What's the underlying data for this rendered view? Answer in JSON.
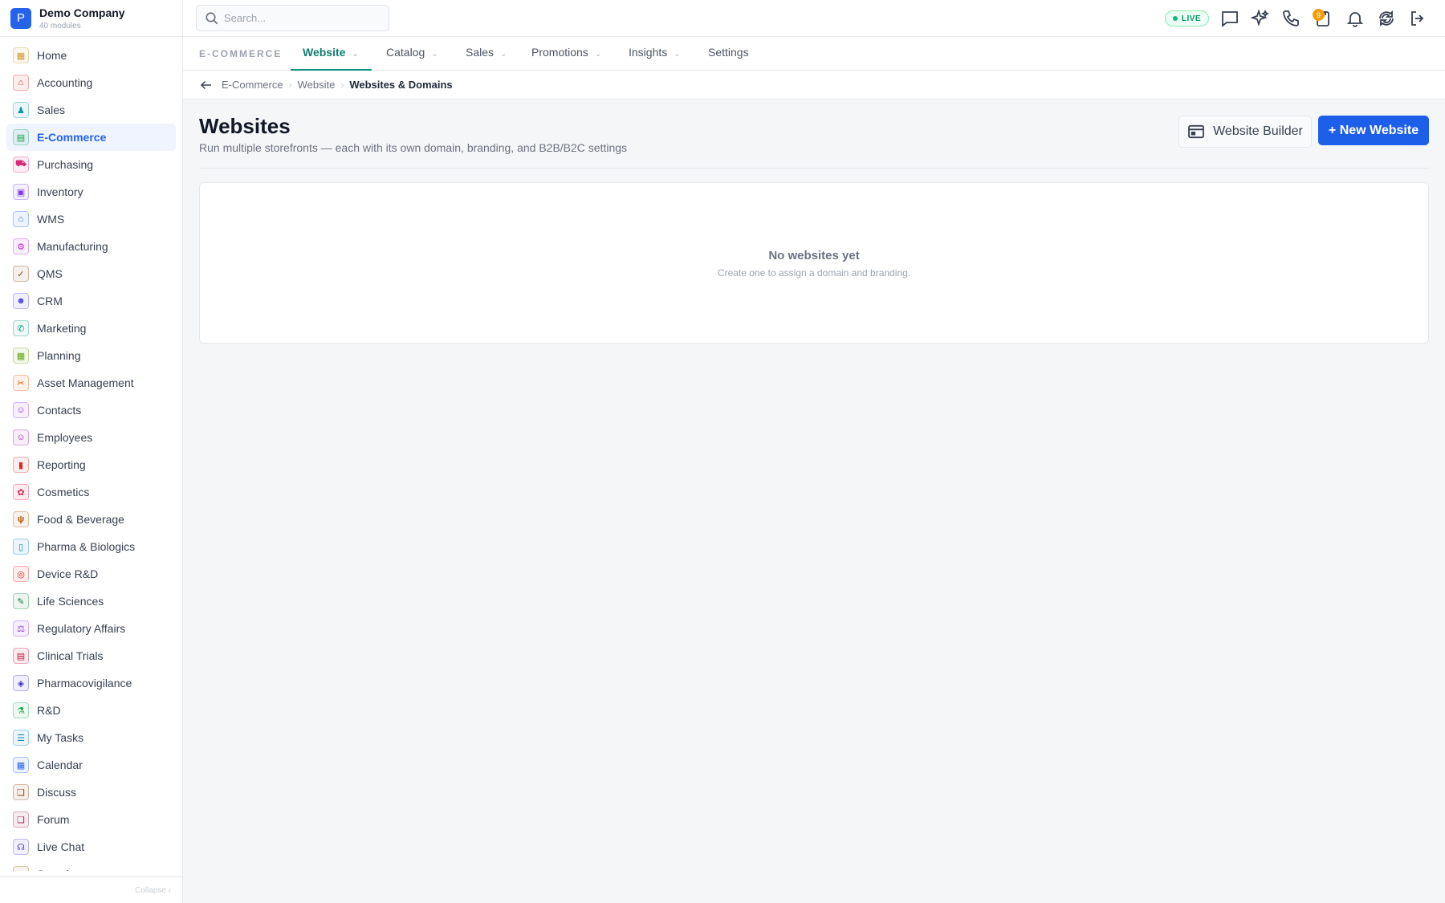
{
  "company": {
    "initial": "P",
    "name": "Demo Company",
    "modules_count": "40 modules"
  },
  "sidebar": {
    "items": [
      {
        "label": "Home",
        "icon": "grid-icon",
        "color": "#c99a2e",
        "glyph": "▦"
      },
      {
        "label": "Accounting",
        "icon": "bank-icon",
        "color": "#dc2626",
        "glyph": "⌂"
      },
      {
        "label": "Sales",
        "icon": "user-tie-icon",
        "color": "#0891b2",
        "glyph": "♟"
      },
      {
        "label": "E-Commerce",
        "icon": "storefront-icon",
        "color": "#16a34a",
        "glyph": "▤",
        "active": true
      },
      {
        "label": "Purchasing",
        "icon": "cart-icon",
        "color": "#db2777",
        "glyph": "⛟"
      },
      {
        "label": "Inventory",
        "icon": "box-icon",
        "color": "#7c3aed",
        "glyph": "▣"
      },
      {
        "label": "WMS",
        "icon": "warehouse-icon",
        "color": "#2563eb",
        "glyph": "⌂"
      },
      {
        "label": "Manufacturing",
        "icon": "factory-icon",
        "color": "#c026d3",
        "glyph": "⚙"
      },
      {
        "label": "QMS",
        "icon": "check-badge-icon",
        "color": "#92400e",
        "glyph": "✓"
      },
      {
        "label": "CRM",
        "icon": "users-icon",
        "color": "#4f46e5",
        "glyph": "☻"
      },
      {
        "label": "Marketing",
        "icon": "megaphone-icon",
        "color": "#0d9488",
        "glyph": "✆"
      },
      {
        "label": "Planning",
        "icon": "calendar-grid-icon",
        "color": "#65a30d",
        "glyph": "▦"
      },
      {
        "label": "Asset Management",
        "icon": "tools-icon",
        "color": "#ea580c",
        "glyph": "✂"
      },
      {
        "label": "Contacts",
        "icon": "contact-card-icon",
        "color": "#9333ea",
        "glyph": "☺"
      },
      {
        "label": "Employees",
        "icon": "badge-icon",
        "color": "#a21caf",
        "glyph": "☺"
      },
      {
        "label": "Reporting",
        "icon": "bar-chart-icon",
        "color": "#dc2626",
        "glyph": "▮"
      },
      {
        "label": "Cosmetics",
        "icon": "lotus-icon",
        "color": "#e11d48",
        "glyph": "✿"
      },
      {
        "label": "Food & Beverage",
        "icon": "fork-knife-icon",
        "color": "#b45309",
        "glyph": "ψ"
      },
      {
        "label": "Pharma & Biologics",
        "icon": "pill-bottle-icon",
        "color": "#0284c7",
        "glyph": "▯"
      },
      {
        "label": "Device R&D",
        "icon": "device-icon",
        "color": "#dc2626",
        "glyph": "◎"
      },
      {
        "label": "Life Sciences",
        "icon": "microscope-icon",
        "color": "#15803d",
        "glyph": "✎"
      },
      {
        "label": "Regulatory Affairs",
        "icon": "gavel-icon",
        "color": "#9333ea",
        "glyph": "⚖"
      },
      {
        "label": "Clinical Trials",
        "icon": "clipboard-icon",
        "color": "#be123c",
        "glyph": "▤"
      },
      {
        "label": "Pharmacovigilance",
        "icon": "shield-icon",
        "color": "#4338ca",
        "glyph": "◈"
      },
      {
        "label": "R&D",
        "icon": "flask-icon",
        "color": "#16a34a",
        "glyph": "⚗"
      },
      {
        "label": "My Tasks",
        "icon": "checklist-icon",
        "color": "#0284c7",
        "glyph": "☰"
      },
      {
        "label": "Calendar",
        "icon": "calendar-icon",
        "color": "#2563eb",
        "glyph": "▦"
      },
      {
        "label": "Discuss",
        "icon": "chat-bubbles-icon",
        "color": "#92400e",
        "glyph": "❏"
      },
      {
        "label": "Forum",
        "icon": "forum-icon",
        "color": "#9d174d",
        "glyph": "❏"
      },
      {
        "label": "Live Chat",
        "icon": "headset-icon",
        "color": "#4f46e5",
        "glyph": "☊"
      },
      {
        "label": "Sourcing",
        "icon": "globe-icon",
        "color": "#a16207",
        "glyph": "◉"
      }
    ],
    "collapse_label": "Collapse ‹"
  },
  "topbar": {
    "search_placeholder": "Search...",
    "live_label": "LIVE",
    "notifications_count": "9"
  },
  "tabs": {
    "module_label": "E-COMMERCE",
    "items": [
      {
        "label": "Website",
        "dropdown": true,
        "active": true
      },
      {
        "label": "Catalog",
        "dropdown": true
      },
      {
        "label": "Sales",
        "dropdown": true
      },
      {
        "label": "Promotions",
        "dropdown": true
      },
      {
        "label": "Insights",
        "dropdown": true
      },
      {
        "label": "Settings",
        "dropdown": false
      }
    ]
  },
  "breadcrumb": {
    "items": [
      "E-Commerce",
      "Website"
    ],
    "current": "Websites & Domains"
  },
  "page": {
    "title": "Websites",
    "subtitle": "Run multiple storefronts — each with its own domain, branding, and B2B/B2C settings",
    "builder_button": "Website Builder",
    "new_button": "+ New Website"
  },
  "empty_state": {
    "title": "No websites yet",
    "subtitle": "Create one to assign a domain and branding."
  },
  "colors": {
    "accent": "#2563eb",
    "primary_button": "#1d5fe8",
    "active_tab": "#0d7e6e",
    "live": "#10b981",
    "badge": "#f59e0b"
  }
}
